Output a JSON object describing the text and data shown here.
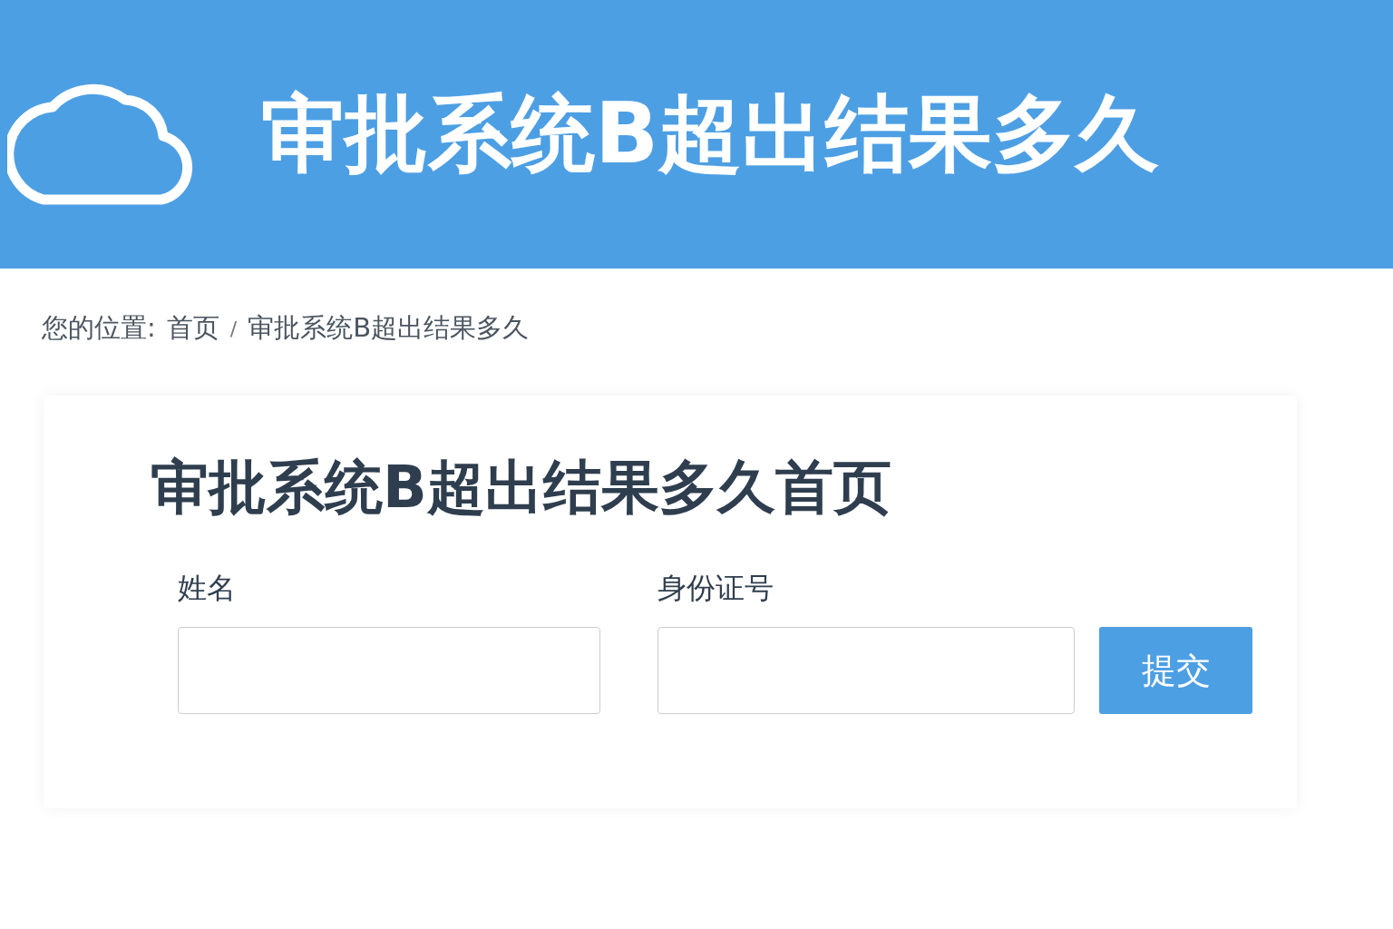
{
  "header": {
    "title": "审批系统B超出结果多久"
  },
  "breadcrumb": {
    "label": "您的位置:",
    "items": [
      {
        "text": "首页"
      },
      {
        "text": "审批系统B超出结果多久"
      }
    ],
    "separator": "/"
  },
  "card": {
    "title": "审批系统B超出结果多久首页",
    "fields": [
      {
        "label": "姓名"
      },
      {
        "label": "身份证号"
      }
    ],
    "button": "提交"
  }
}
